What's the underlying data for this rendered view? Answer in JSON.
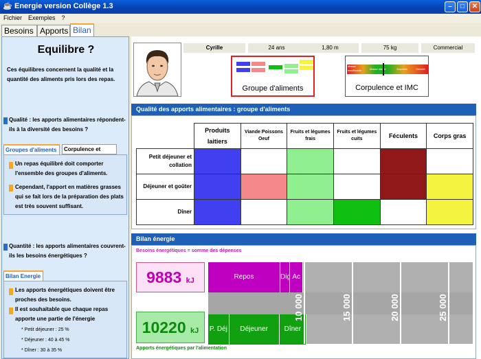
{
  "window": {
    "title": "Energie version Collège 1.3"
  },
  "menu": [
    "Fichier",
    "Exemples",
    "?"
  ],
  "tabs": [
    "Besoins",
    "Apports",
    "Bilan"
  ],
  "active_tab": "Bilan",
  "left": {
    "title": "Equilibre ?",
    "intro": "Ces équilibres concernent la qualité et la quantité des aliments pris lors des repas.",
    "q_quality": "Qualité : les apports alimentaires répondent-ils à la diversité des besoins ?",
    "subtabs": [
      "Groupes d'aliments",
      "Corpulence et I.M.C"
    ],
    "quality_points": [
      "Un repas équilibré doit comporter l'ensemble des groupes d'aliments.",
      "Cependant, l'apport en matières grasses qui se fait lors de la préparation des plats est très souvent suffisant."
    ],
    "q_quantity": "Quantité : les apports alimentaires couvrent-ils les besoins énergétiques ?",
    "energy_tab": "Bilan Energie",
    "energy_points": [
      "Les apports énergétiques doivent être proches des besoins.",
      "Il est souhaitable que chaque repas apporte une partie de l'énergie"
    ],
    "meal_shares": [
      "* Petit déjeuner : 25 %",
      "* Déjeuner : 40 à 45 %",
      "* Dîner : 30 à 35 %"
    ]
  },
  "profile": {
    "name": "Cyrille",
    "age": "24 ans",
    "height": "1,80 m",
    "weight": "75 kg",
    "job": "Commercial"
  },
  "cards": {
    "groups": "Groupe d'aliments",
    "imc": "Corpulence et IMC",
    "imc_scale": [
      "Masse insuffisante",
      "Masse idéale",
      "Surpoids",
      "Obésité"
    ]
  },
  "quality": {
    "heading": "Qualité des apports alimentaires : groupe d'aliments",
    "columns": [
      "Produits laitiers",
      "Viande Poissons Oeuf",
      "Fruits et légumes frais",
      "Fruits et légumes cuits",
      "Féculents",
      "Corps gras"
    ],
    "rows": [
      {
        "label": "Petit déjeuner et collation",
        "cells": [
          "#4040f0",
          "#ffffff",
          "#90f090",
          "#ffffff",
          "#901818",
          "#ffffff"
        ]
      },
      {
        "label": "Déjeuner et goûter",
        "cells": [
          "#4040f0",
          "#f48888",
          "#90f090",
          "#ffffff",
          "#901818",
          "#f4f440"
        ]
      },
      {
        "label": "Dîner",
        "cells": [
          "#4040f0",
          "#ffffff",
          "#90f090",
          "#10c010",
          "#ffffff",
          "#f4f440"
        ]
      }
    ]
  },
  "energy": {
    "heading": "Bilan énergie",
    "needs_caption": "Besoins énergétiques = somme des dépenses",
    "supply_caption": "Apports énergétiques par l'alimentation",
    "needs_value": "9883",
    "supply_value": "10220",
    "unit": "kJ",
    "ticks": [
      "10 000",
      "15 000",
      "20 000",
      "25 000"
    ]
  },
  "chart_data": {
    "type": "bar",
    "orientation": "horizontal-stacked",
    "x_axis_ticks": [
      10000,
      15000,
      20000,
      25000
    ],
    "series": [
      {
        "name": "Besoins énergétiques",
        "segments": [
          {
            "label": "Repos",
            "value": 7500
          },
          {
            "label": "Dig",
            "value": 1000
          },
          {
            "label": "Ac",
            "value": 1383
          }
        ]
      },
      {
        "name": "Apports énergétiques",
        "segments": [
          {
            "label": "P. Déj",
            "value": 2200
          },
          {
            "label": "Déjeuner",
            "value": 5200
          },
          {
            "label": "Dîner",
            "value": 2820
          }
        ]
      }
    ]
  }
}
